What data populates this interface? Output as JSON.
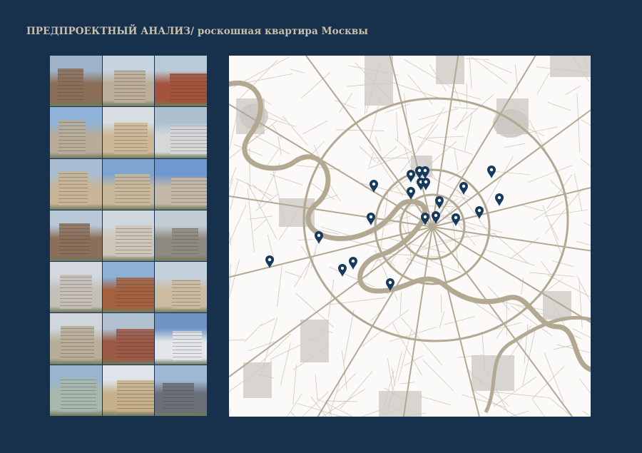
{
  "header": {
    "title_main": "ПРЕДПРОЕКТНЫЙ АНАЛИЗ/",
    "title_sub": " роскошная квартира Москвы"
  },
  "gallery": {
    "count": 21
  },
  "map": {
    "pin_color": "#163a5e",
    "road_color": "#b3a992",
    "block_color": "#c9c4c0",
    "pin_count": 21
  }
}
